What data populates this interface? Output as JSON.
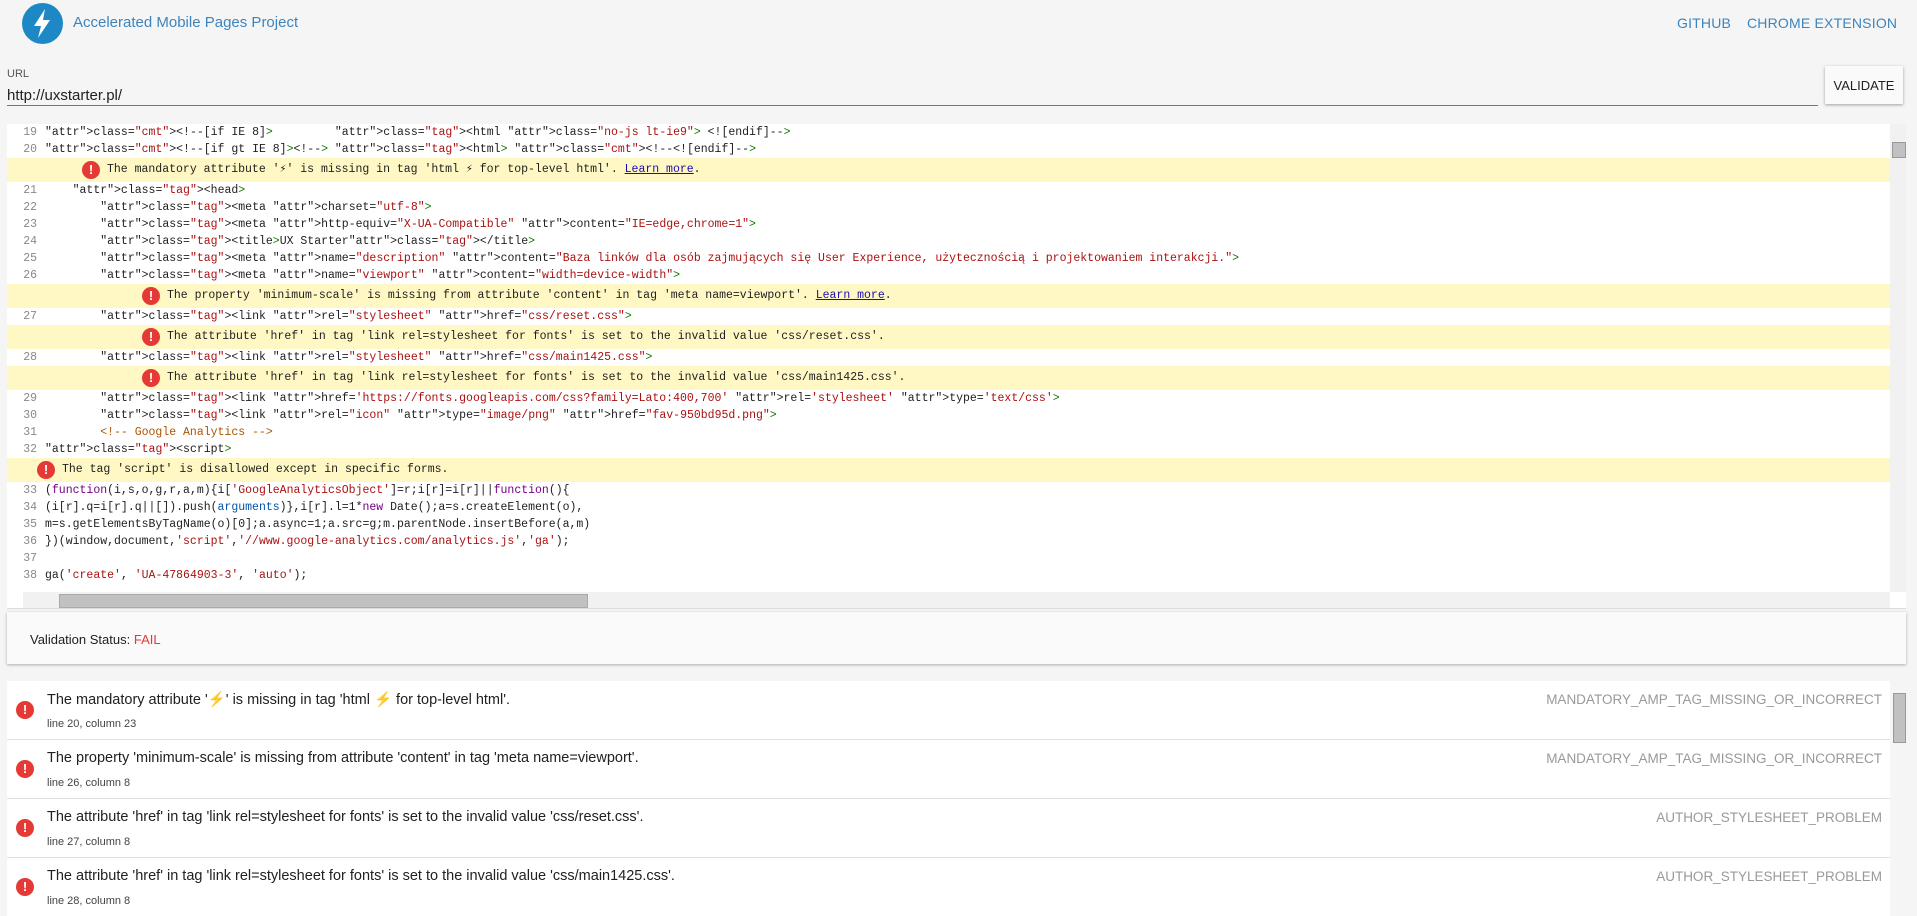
{
  "header": {
    "title": "Accelerated Mobile Pages Project",
    "nav": [
      "GITHUB",
      "CHROME EXTENSION"
    ],
    "logo_icon": "lightning-bolt-icon",
    "brand_color": "#1e88c7"
  },
  "url_field": {
    "label": "URL",
    "value": "http://uxstarter.pl/"
  },
  "validate_label": "VALIDATE",
  "editor": {
    "lines": [
      {
        "n": "19",
        "text": "<!--[if IE 8]>         <html class=\"no-js lt-ie9\"> <![endif]-->"
      },
      {
        "n": "20",
        "text": "<!--[if gt IE 8]><!--> <html> <!--<![endif]-->"
      },
      {
        "error": "The mandatory attribute '⚡' is missing in tag 'html ⚡ for top-level html'.",
        "learn": "Learn more",
        "indent": 1
      },
      {
        "n": "21",
        "text": "    <head>"
      },
      {
        "n": "22",
        "text": "        <meta charset=\"utf-8\">"
      },
      {
        "n": "23",
        "text": "        <meta http-equiv=\"X-UA-Compatible\" content=\"IE=edge,chrome=1\">"
      },
      {
        "n": "24",
        "text": "        <title>UX Starter</title>"
      },
      {
        "n": "25",
        "text": "        <meta name=\"description\" content=\"Baza linków dla osób zajmujących się User Experience, użytecznością i projektowaniem interakcji.\">"
      },
      {
        "n": "26",
        "text": "        <meta name=\"viewport\" content=\"width=device-width\">"
      },
      {
        "error": "The property 'minimum-scale' is missing from attribute 'content' in tag 'meta name=viewport'.",
        "learn": "Learn more",
        "indent": 2
      },
      {
        "n": "27",
        "text": "        <link rel=\"stylesheet\" href=\"css/reset.css\">"
      },
      {
        "error": "The attribute 'href' in tag 'link rel=stylesheet for fonts' is set to the invalid value 'css/reset.css'.",
        "indent": 2
      },
      {
        "n": "28",
        "text": "        <link rel=\"stylesheet\" href=\"css/main1425.css\">"
      },
      {
        "error": "The attribute 'href' in tag 'link rel=stylesheet for fonts' is set to the invalid value 'css/main1425.css'.",
        "indent": 2
      },
      {
        "n": "29",
        "text": "        <link href='https://fonts.googleapis.com/css?family=Lato:400,700' rel='stylesheet' type='text/css'>"
      },
      {
        "n": "30",
        "text": "        <link rel=\"icon\" type=\"image/png\" href=\"fav-950bd95d.png\">"
      },
      {
        "n": "31",
        "text": "        <!-- Google Analytics -->"
      },
      {
        "n": "32",
        "text": "<script>"
      },
      {
        "error": "The tag 'script' is disallowed except in specific forms.",
        "indent": 0
      },
      {
        "n": "33",
        "text": "(function(i,s,o,g,r,a,m){i['GoogleAnalyticsObject']=r;i[r]=i[r]||function(){"
      },
      {
        "n": "34",
        "text": "(i[r].q=i[r].q||[]).push(arguments)},i[r].l=1*new Date();a=s.createElement(o),"
      },
      {
        "n": "35",
        "text": "m=s.getElementsByTagName(o)[0];a.async=1;a.src=g;m.parentNode.insertBefore(a,m)"
      },
      {
        "n": "36",
        "text": "})(window,document,'script','//www.google-analytics.com/analytics.js','ga');"
      },
      {
        "n": "37",
        "text": ""
      },
      {
        "n": "38",
        "text": "ga('create', 'UA-47864903-3', 'auto');"
      }
    ]
  },
  "status": {
    "label": "Validation Status:",
    "value": "FAIL",
    "fail_color": "#e53935"
  },
  "errors": [
    {
      "message": "The mandatory attribute '⚡' is missing in tag 'html ⚡ for top-level html'.",
      "location": "line 20, column 23",
      "code": "MANDATORY_AMP_TAG_MISSING_OR_INCORRECT"
    },
    {
      "message": "The property 'minimum-scale' is missing from attribute 'content' in tag 'meta name=viewport'.",
      "location": "line 26, column 8",
      "code": "MANDATORY_AMP_TAG_MISSING_OR_INCORRECT"
    },
    {
      "message": "The attribute 'href' in tag 'link rel=stylesheet for fonts' is set to the invalid value 'css/reset.css'.",
      "location": "line 27, column 8",
      "code": "AUTHOR_STYLESHEET_PROBLEM"
    },
    {
      "message": "The attribute 'href' in tag 'link rel=stylesheet for fonts' is set to the invalid value 'css/main1425.css'.",
      "location": "line 28, column 8",
      "code": "AUTHOR_STYLESHEET_PROBLEM"
    }
  ]
}
